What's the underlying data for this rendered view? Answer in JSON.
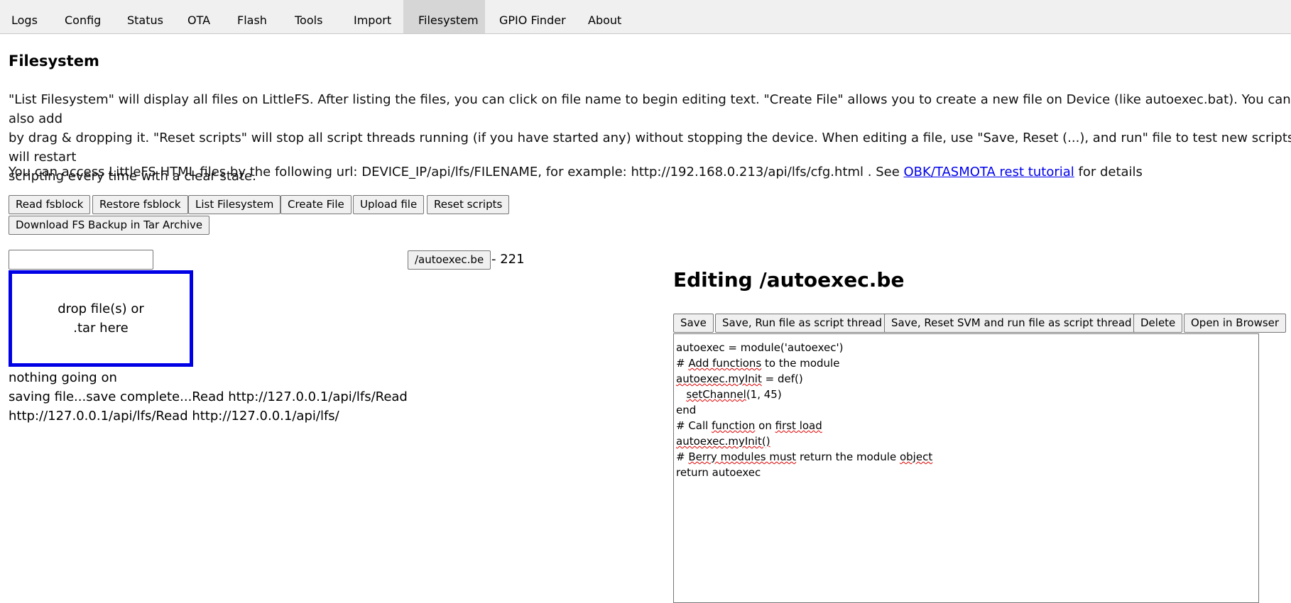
{
  "tabs": [
    {
      "label": "Logs",
      "active": false
    },
    {
      "label": "Config",
      "active": false
    },
    {
      "label": "Status",
      "active": false
    },
    {
      "label": "OTA",
      "active": false
    },
    {
      "label": "Flash",
      "active": false
    },
    {
      "label": "Tools",
      "active": false
    },
    {
      "label": "Import",
      "active": false
    },
    {
      "label": "Filesystem",
      "active": true
    },
    {
      "label": "GPIO Finder",
      "active": false
    },
    {
      "label": "About",
      "active": false
    }
  ],
  "page": {
    "title": "Filesystem",
    "intro": "\"List Filesystem\" will display all files on LittleFS. After listing the files, you can click on file name to begin editing text. \"Create File\" allows you to create a new file on Device (like autoexec.bat). You can also add\nby drag & dropping it. \"Reset scripts\" will stop all script threads running (if you have started any) without stopping the device. When editing a file, use \"Save, Reset (...), and run\" file to test new scripts, it will restart\nscripting every time with a clear state.",
    "access_text": "You can access LittleFS HTML files by the following url: DEVICE_IP/api/lfs/FILENAME, for example: http://192.168.0.213/api/lfs/cfg.html . See ",
    "access_link": "OBK/TASMOTA rest tutorial",
    "access_suffix": " for details"
  },
  "toolbar": {
    "read_fsblock": "Read fsblock",
    "restore_fsblock": "Restore fsblock",
    "list_filesystem": "List Filesystem",
    "create_file": "Create File",
    "upload_file": "Upload file",
    "reset_scripts": "Reset scripts",
    "download_backup": "Download FS Backup in Tar Archive"
  },
  "file_list": {
    "new_file_name": "",
    "file_label": "/autoexec.be",
    "file_size": "- 221"
  },
  "dropzone": {
    "text": "drop file(s) or\n.tar here",
    "border_color": "#0000e6"
  },
  "status": {
    "line1": "nothing going on",
    "line2": "saving file...save complete...Read http://127.0.0.1/api/lfs/Read",
    "line3": "http://127.0.0.1/api/lfs/Read http://127.0.0.1/api/lfs/"
  },
  "editor": {
    "title": "Editing /autoexec.be",
    "save": "Save",
    "save_run": "Save, Run file as script thread",
    "save_reset_run": "Save, Reset SVM and run file as script thread",
    "delete": "Delete",
    "open_browser": "Open in Browser",
    "lines": [
      "autoexec = module('autoexec')",
      "",
      "# Add functions to the module",
      "autoexec.myInit = def()",
      "   setChannel(1, 45)",
      "end",
      "",
      "# Call function on first load",
      "autoexec.myInit()",
      "",
      "# Berry modules must return the module object",
      "return autoexec"
    ]
  }
}
